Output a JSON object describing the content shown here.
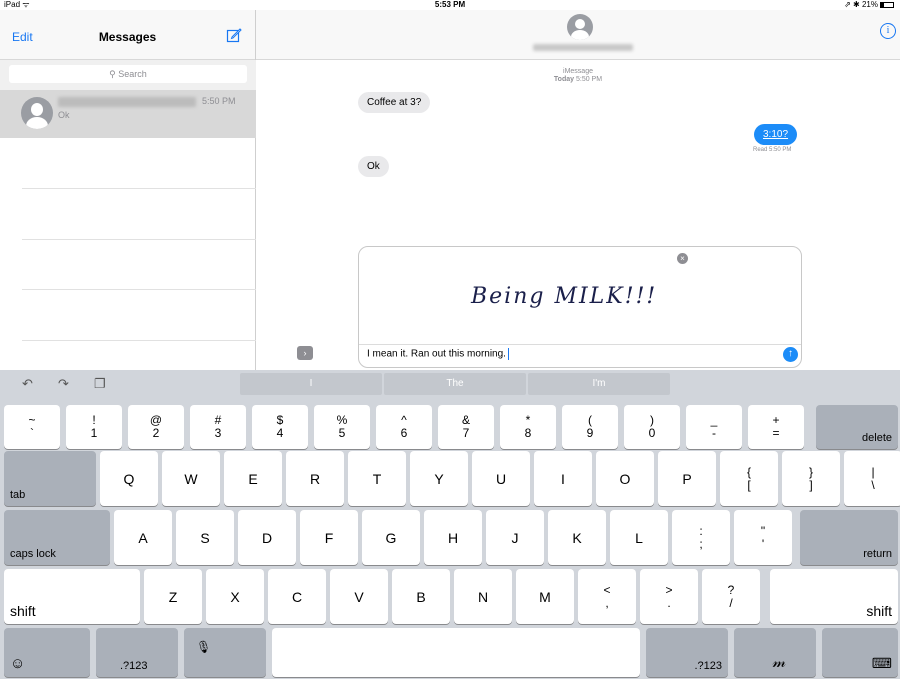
{
  "status_bar": {
    "left": "iPad ᯤ",
    "time": "5:53 PM",
    "right": "⇗ ✱ 21%"
  },
  "sidebar": {
    "edit_label": "Edit",
    "title": "Messages",
    "search_placeholder": "Search",
    "conversations": [
      {
        "time": "5:50 PM",
        "preview": "Ok"
      }
    ]
  },
  "chat": {
    "service": "iMessage",
    "date_label": "Today",
    "date_time": "5:50 PM",
    "messages": [
      {
        "direction": "in",
        "text": "Coffee at 3?"
      },
      {
        "direction": "out",
        "text": "3:10?"
      },
      {
        "direction": "in",
        "text": "Ok"
      }
    ],
    "read_receipt": "Read 5:50 PM",
    "expand_glyph": "›",
    "handwriting_text": "Being MILK!!!",
    "composer_text": "I mean it. Ran out this morning.",
    "send_glyph": "↑",
    "info_glyph": "i",
    "close_glyph": "×"
  },
  "keyboard": {
    "tools": {
      "undo": "↶",
      "redo": "↷",
      "paste": "❐"
    },
    "suggestions": [
      "I",
      "The",
      "I'm"
    ],
    "row1": [
      {
        "top": "~",
        "bottom": "`"
      },
      {
        "top": "!",
        "bottom": "1"
      },
      {
        "top": "@",
        "bottom": "2"
      },
      {
        "top": "#",
        "bottom": "3"
      },
      {
        "top": "$",
        "bottom": "4"
      },
      {
        "top": "%",
        "bottom": "5"
      },
      {
        "top": "^",
        "bottom": "6"
      },
      {
        "top": "&",
        "bottom": "7"
      },
      {
        "top": "*",
        "bottom": "8"
      },
      {
        "top": "(",
        "bottom": "9"
      },
      {
        "top": ")",
        "bottom": "0"
      },
      {
        "top": "_",
        "bottom": "-"
      },
      {
        "top": "+",
        "bottom": "="
      }
    ],
    "delete_label": "delete",
    "tab_label": "tab",
    "row2": [
      "Q",
      "W",
      "E",
      "R",
      "T",
      "Y",
      "U",
      "I",
      "O",
      "P"
    ],
    "row2_extra": [
      {
        "top": "{",
        "bottom": "["
      },
      {
        "top": "}",
        "bottom": "]"
      },
      {
        "top": "|",
        "bottom": "\\"
      }
    ],
    "caps_label": "caps lock",
    "row3": [
      "A",
      "S",
      "D",
      "F",
      "G",
      "H",
      "J",
      "K",
      "L"
    ],
    "row3_extra": [
      {
        "top": ":",
        "bottom": ";"
      },
      {
        "top": "\"",
        "bottom": "'"
      }
    ],
    "return_label": "return",
    "shift_label": "shift",
    "row4": [
      "Z",
      "X",
      "C",
      "V",
      "B",
      "N",
      "M"
    ],
    "row4_extra": [
      {
        "top": "<",
        "bottom": ","
      },
      {
        "top": ">",
        "bottom": "."
      },
      {
        "top": "?",
        "bottom": "/"
      }
    ],
    "emoji_glyph": "☺",
    "numbers_label": ".?123",
    "mic_glyph": "🎙",
    "handwriting_glyph": "𝓂",
    "hide_glyph": "⌨"
  }
}
